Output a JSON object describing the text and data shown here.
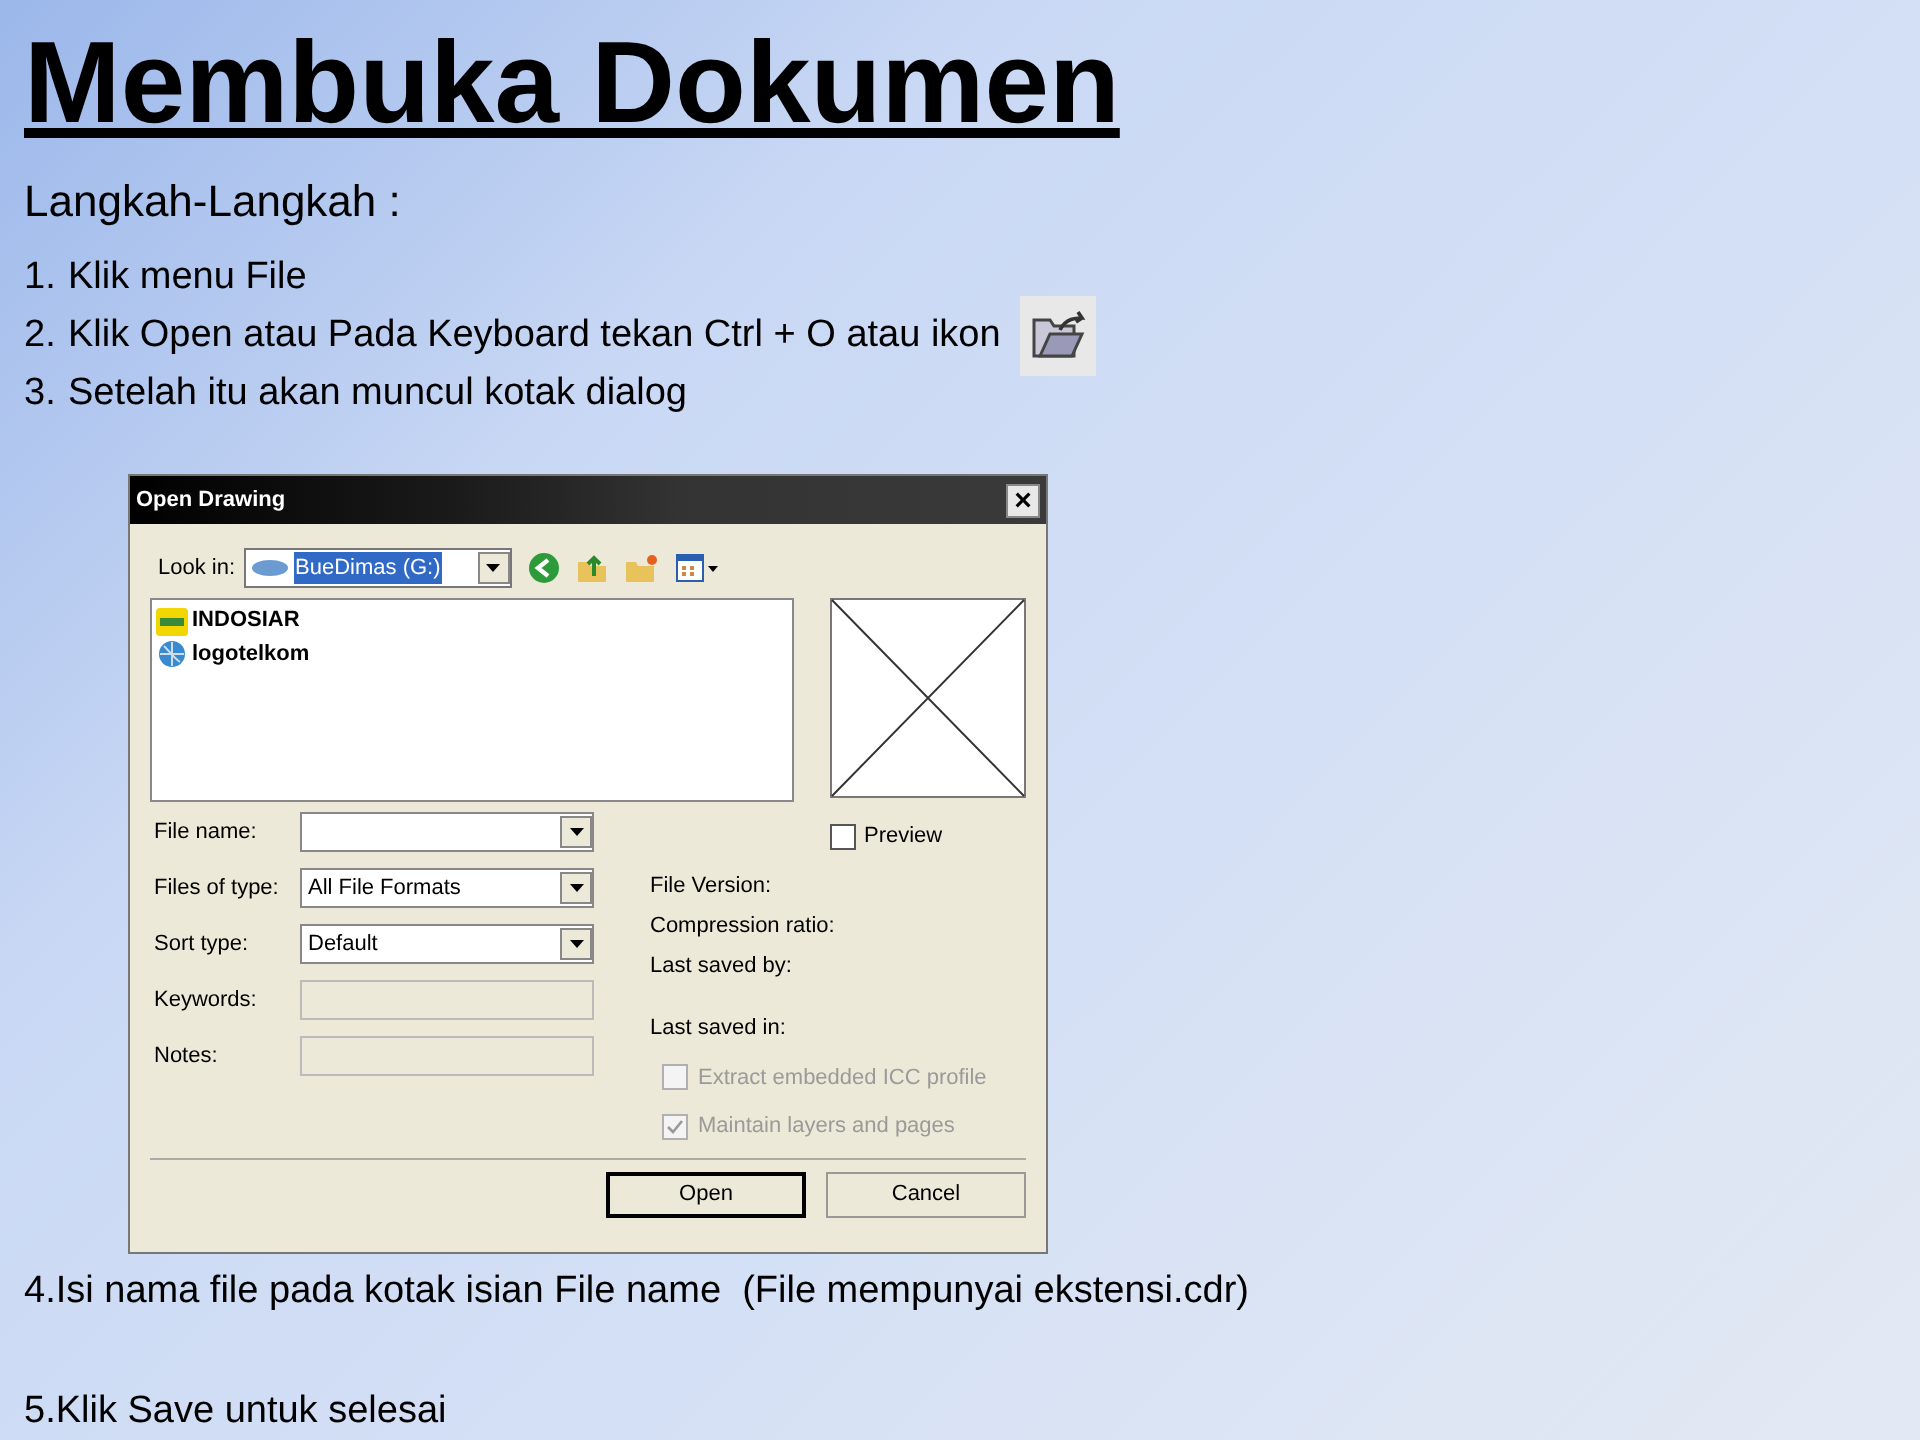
{
  "title": "Membuka Dokumen",
  "subtitle": "Langkah-Langkah :",
  "steps": [
    {
      "number": "1.",
      "text": "Klik menu File",
      "kind": "plain"
    },
    {
      "number": "2.",
      "text": "Klik Open atau Pada Keyboard tekan Ctrl + O atau ikon",
      "kind": "with_icon"
    },
    {
      "number": "3.",
      "text": "Setelah itu akan muncul kotak dialog",
      "kind": "plain"
    }
  ],
  "dialog": {
    "title": "Open Drawing",
    "close": "×",
    "look_in": {
      "label": "Look in:",
      "value": "BueDimas (G:)"
    },
    "files": [
      {
        "name": "INDOSIAR",
        "kind": "logo"
      },
      {
        "name": "logotelkom",
        "kind": "globe"
      }
    ],
    "fields": [
      {
        "label": "File name:",
        "kind": "dropdown"
      },
      {
        "label": "Files of type:",
        "value": "All File Formats",
        "kind": "dropdown"
      },
      {
        "label": "Sort type:",
        "value": "Default",
        "kind": "dropdown"
      },
      {
        "label": "Keywords:",
        "kind": "text"
      },
      {
        "label": "Notes:",
        "kind": "text"
      }
    ],
    "preview": {
      "label": "Preview",
      "checked": false
    },
    "info": [
      "File Version:",
      "Compression ratio:",
      "Last saved by:",
      "Last saved in:"
    ],
    "options": [
      {
        "label": "Extract embedded ICC profile",
        "checked": false,
        "disabled": true
      },
      {
        "label": "Maintain layers and pages",
        "checked": true,
        "disabled": true
      }
    ],
    "buttons": [
      {
        "label": "Open",
        "default": true
      },
      {
        "label": "Cancel",
        "default": false
      }
    ]
  },
  "later_steps": [
    "4.Isi nama file pada kotak isian File name  (File mempunyai ekstensi.cdr)",
    "5.Klik Save untuk selesai"
  ]
}
